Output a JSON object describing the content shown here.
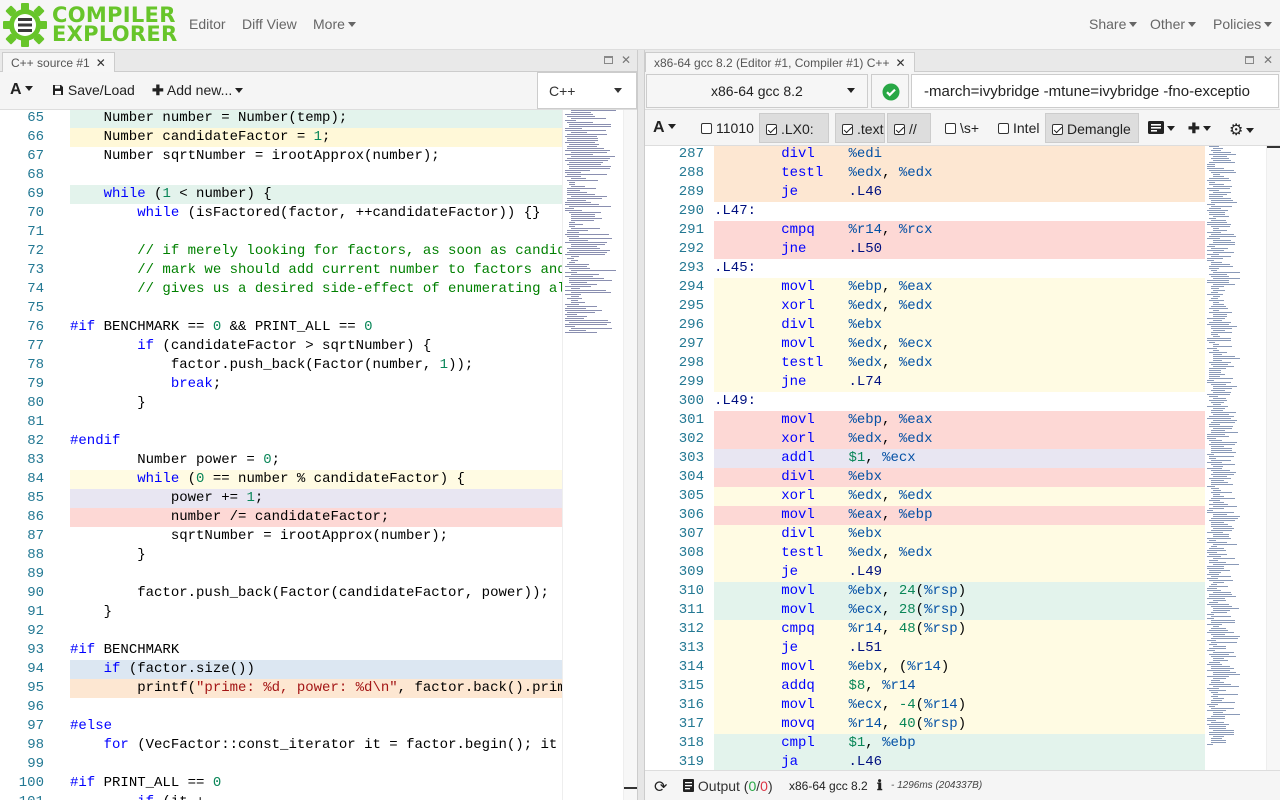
{
  "navbar": {
    "logo_line1": "COMPILER",
    "logo_line2": "EXPLORER",
    "links": [
      "Editor",
      "Diff View",
      "More"
    ],
    "right_links": [
      "Share",
      "Other",
      "Policies"
    ]
  },
  "source_pane": {
    "tab_title": "C++ source #1",
    "toolbar": {
      "font_label": "A",
      "save_load": "Save/Load",
      "add_new": "Add new..."
    },
    "language": "C++",
    "lines": [
      {
        "n": "65",
        "bg": "#e3f3ec",
        "code": "    Number number = Number(temp);"
      },
      {
        "n": "66",
        "bg": "#fff8d8",
        "code": "    Number candidateFactor = 1;"
      },
      {
        "n": "67",
        "bg": "",
        "code": "    Number sqrtNumber = irootApprox(number);"
      },
      {
        "n": "68",
        "bg": "",
        "code": ""
      },
      {
        "n": "69",
        "bg": "#e3f3ec",
        "code": "    while (1 < number) {"
      },
      {
        "n": "70",
        "bg": "",
        "code": "        while (isFactored(factor, ++candidateFactor)) {}"
      },
      {
        "n": "71",
        "bg": "",
        "code": ""
      },
      {
        "n": "72",
        "bg": "",
        "code": "        // if merely looking for factors, as soon as candidate"
      },
      {
        "n": "73",
        "bg": "",
        "code": "        // mark we should add current number to factors and bu"
      },
      {
        "n": "74",
        "bg": "",
        "code": "        // gives us a desired side-effect of enumerating all p"
      },
      {
        "n": "75",
        "bg": "",
        "code": ""
      },
      {
        "n": "76",
        "bg": "",
        "code": "#if BENCHMARK == 0 && PRINT_ALL == 0"
      },
      {
        "n": "77",
        "bg": "",
        "code": "        if (candidateFactor > sqrtNumber) {"
      },
      {
        "n": "78",
        "bg": "",
        "code": "            factor.push_back(Factor(number, 1));"
      },
      {
        "n": "79",
        "bg": "",
        "code": "            break;"
      },
      {
        "n": "80",
        "bg": "",
        "code": "        }"
      },
      {
        "n": "81",
        "bg": "",
        "code": ""
      },
      {
        "n": "82",
        "bg": "",
        "code": "#endif"
      },
      {
        "n": "83",
        "bg": "",
        "code": "        Number power = 0;"
      },
      {
        "n": "84",
        "bg": "#fffbe3",
        "code": "        while (0 == number % candidateFactor) {"
      },
      {
        "n": "85",
        "bg": "#e8e6f2",
        "code": "            power += 1;"
      },
      {
        "n": "86",
        "bg": "#fdd8d5",
        "code": "            number /= candidateFactor;"
      },
      {
        "n": "87",
        "bg": "",
        "code": "            sqrtNumber = irootApprox(number);"
      },
      {
        "n": "88",
        "bg": "",
        "code": "        }"
      },
      {
        "n": "89",
        "bg": "",
        "code": ""
      },
      {
        "n": "90",
        "bg": "",
        "code": "        factor.push_back(Factor(candidateFactor, power));"
      },
      {
        "n": "91",
        "bg": "",
        "code": "    }"
      },
      {
        "n": "92",
        "bg": "",
        "code": ""
      },
      {
        "n": "93",
        "bg": "",
        "code": "#if BENCHMARK"
      },
      {
        "n": "94",
        "bg": "#dce7f2",
        "code": "    if (factor.size())"
      },
      {
        "n": "95",
        "bg": "#fde7d2",
        "code": "        printf(\"prime: %d, power: %d\\n\", factor.back().prime,"
      },
      {
        "n": "96",
        "bg": "",
        "code": ""
      },
      {
        "n": "97",
        "bg": "",
        "code": "#else"
      },
      {
        "n": "98",
        "bg": "",
        "code": "    for (VecFactor::const_iterator it = factor.begin(); it !="
      },
      {
        "n": "99",
        "bg": "",
        "code": ""
      },
      {
        "n": "100",
        "bg": "",
        "code": "#if PRINT_ALL == 0"
      },
      {
        "n": "101",
        "bg": "",
        "code": "        if (it + ..."
      }
    ]
  },
  "asm_pane": {
    "tab_title": "x86-64 gcc 8.2 (Editor #1, Compiler #1) C++",
    "compiler": "x86-64 gcc 8.2",
    "flags": "-march=ivybridge -mtune=ivybridge -fno-exceptio",
    "filters": [
      {
        "label": "11010",
        "checked": false,
        "on": false
      },
      {
        "label": ".LX0:",
        "checked": true,
        "on": true
      },
      {
        "label": ".text",
        "checked": true,
        "on": true
      },
      {
        "label": "//",
        "checked": true,
        "on": true
      },
      {
        "label": "\\s+",
        "checked": false,
        "on": false
      },
      {
        "label": "Intel",
        "checked": false,
        "on": false
      },
      {
        "label": "Demangle",
        "checked": true,
        "on": true
      }
    ],
    "lines": [
      {
        "n": "287",
        "bg": "#fde7d2",
        "code": "        divl    %edi"
      },
      {
        "n": "288",
        "bg": "#fde7d2",
        "code": "        testl   %edx, %edx"
      },
      {
        "n": "289",
        "bg": "#fde7d2",
        "code": "        je      .L46"
      },
      {
        "n": "290",
        "bg": "",
        "code": ".L47:"
      },
      {
        "n": "291",
        "bg": "#fdd8d5",
        "code": "        cmpq    %r14, %rcx"
      },
      {
        "n": "292",
        "bg": "#fdd8d5",
        "code": "        jne     .L50"
      },
      {
        "n": "293",
        "bg": "",
        "code": ".L45:"
      },
      {
        "n": "294",
        "bg": "#fffbe3",
        "code": "        movl    %ebp, %eax"
      },
      {
        "n": "295",
        "bg": "#fffbe3",
        "code": "        xorl    %edx, %edx"
      },
      {
        "n": "296",
        "bg": "#fffbe3",
        "code": "        divl    %ebx"
      },
      {
        "n": "297",
        "bg": "#fffbe3",
        "code": "        movl    %edx, %ecx"
      },
      {
        "n": "298",
        "bg": "#fffbe3",
        "code": "        testl   %edx, %edx"
      },
      {
        "n": "299",
        "bg": "#fffbe3",
        "code": "        jne     .L74"
      },
      {
        "n": "300",
        "bg": "",
        "code": ".L49:"
      },
      {
        "n": "301",
        "bg": "#fdd8d5",
        "code": "        movl    %ebp, %eax"
      },
      {
        "n": "302",
        "bg": "#fdd8d5",
        "code": "        xorl    %edx, %edx"
      },
      {
        "n": "303",
        "bg": "#e8e6f2",
        "code": "        addl    $1, %ecx"
      },
      {
        "n": "304",
        "bg": "#fdd8d5",
        "code": "        divl    %ebx"
      },
      {
        "n": "305",
        "bg": "#fffbe3",
        "code": "        xorl    %edx, %edx"
      },
      {
        "n": "306",
        "bg": "#fdd8d5",
        "code": "        movl    %eax, %ebp"
      },
      {
        "n": "307",
        "bg": "#fffbe3",
        "code": "        divl    %ebx"
      },
      {
        "n": "308",
        "bg": "#fffbe3",
        "code": "        testl   %edx, %edx"
      },
      {
        "n": "309",
        "bg": "#fffbe3",
        "code": "        je      .L49"
      },
      {
        "n": "310",
        "bg": "#e3f3ec",
        "code": "        movl    %ebx, 24(%rsp)"
      },
      {
        "n": "311",
        "bg": "#e3f3ec",
        "code": "        movl    %ecx, 28(%rsp)"
      },
      {
        "n": "312",
        "bg": "#fffbe3",
        "code": "        cmpq    %r14, 48(%rsp)"
      },
      {
        "n": "313",
        "bg": "#fffbe3",
        "code": "        je      .L51"
      },
      {
        "n": "314",
        "bg": "#fffbe3",
        "code": "        movl    %ebx, (%r14)"
      },
      {
        "n": "315",
        "bg": "#fffbe3",
        "code": "        addq    $8, %r14"
      },
      {
        "n": "316",
        "bg": "#fffbe3",
        "code": "        movl    %ecx, -4(%r14)"
      },
      {
        "n": "317",
        "bg": "#fffbe3",
        "code": "        movq    %r14, 40(%rsp)"
      },
      {
        "n": "318",
        "bg": "#e3f3ec",
        "code": "        cmpl    $1, %ebp"
      },
      {
        "n": "319",
        "bg": "#e3f3ec",
        "code": "        ja      .L46"
      }
    ],
    "status": {
      "output_label": "Output (",
      "output_a": "0",
      "output_sep": "/",
      "output_b": "0",
      "output_close": ")",
      "compiler": "x86-64 gcc 8.2",
      "timing": "- 1296ms (204337B)"
    }
  },
  "colors": {
    "brand_green": "#67c52a",
    "ok_green": "#28a745",
    "error_red": "#dc3545"
  }
}
